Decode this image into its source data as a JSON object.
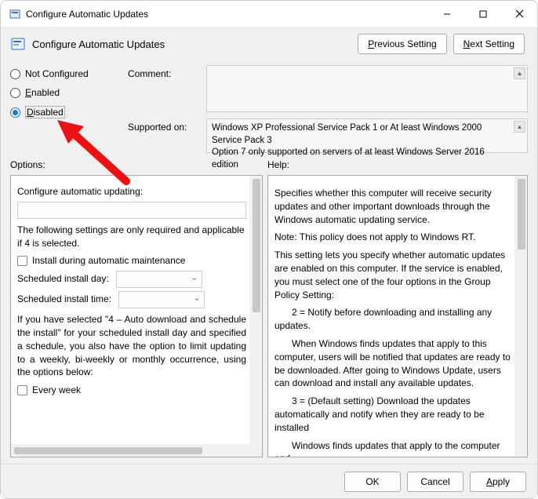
{
  "titlebar": {
    "title": "Configure Automatic Updates"
  },
  "subtitle": {
    "text": "Configure Automatic Updates",
    "prev_btn": "Previous Setting",
    "next_btn": "Next Setting"
  },
  "radios": {
    "not_configured": "Not Configured",
    "enabled": "Enabled",
    "disabled": "Disabled",
    "selected": "disabled"
  },
  "meta": {
    "comment_label": "Comment:",
    "comment_value": "",
    "supported_label": "Supported on:",
    "supported_value": "Windows XP Professional Service Pack 1 or At least Windows 2000 Service Pack 3\nOption 7 only supported on servers of at least Windows Server 2016 edition"
  },
  "section_labels": {
    "options": "Options:",
    "help": "Help:"
  },
  "options_panel": {
    "configure_label": "Configure automatic updating:",
    "configure_value": "",
    "required_note": "The following settings are only required and applicable if 4 is selected.",
    "install_during_maint": "Install during automatic maintenance",
    "sched_day_label": "Scheduled install day:",
    "sched_day_value": "",
    "sched_time_label": "Scheduled install time:",
    "sched_time_value": "",
    "long_note": "If you have selected \"4 – Auto download and schedule the install\" for your scheduled install day and specified a schedule, you also have the option to limit updating to a weekly, bi-weekly or monthly occurrence, using the options below:",
    "every_week": "Every week"
  },
  "help_panel": {
    "p1": "Specifies whether this computer will receive security updates and other important downloads through the Windows automatic updating service.",
    "p2": "Note: This policy does not apply to Windows RT.",
    "p3": "This setting lets you specify whether automatic updates are enabled on this computer. If the service is enabled, you must select one of the four options in the Group Policy Setting:",
    "p4": "2 = Notify before downloading and installing any updates.",
    "p5": "When Windows finds updates that apply to this computer, users will be notified that updates are ready to be downloaded. After going to Windows Update, users can download and install any available updates.",
    "p6": "3 = (Default setting) Download the updates automatically and notify when they are ready to be installed",
    "p7": "Windows finds updates that apply to the computer and"
  },
  "footer": {
    "ok": "OK",
    "cancel": "Cancel",
    "apply": "Apply"
  }
}
